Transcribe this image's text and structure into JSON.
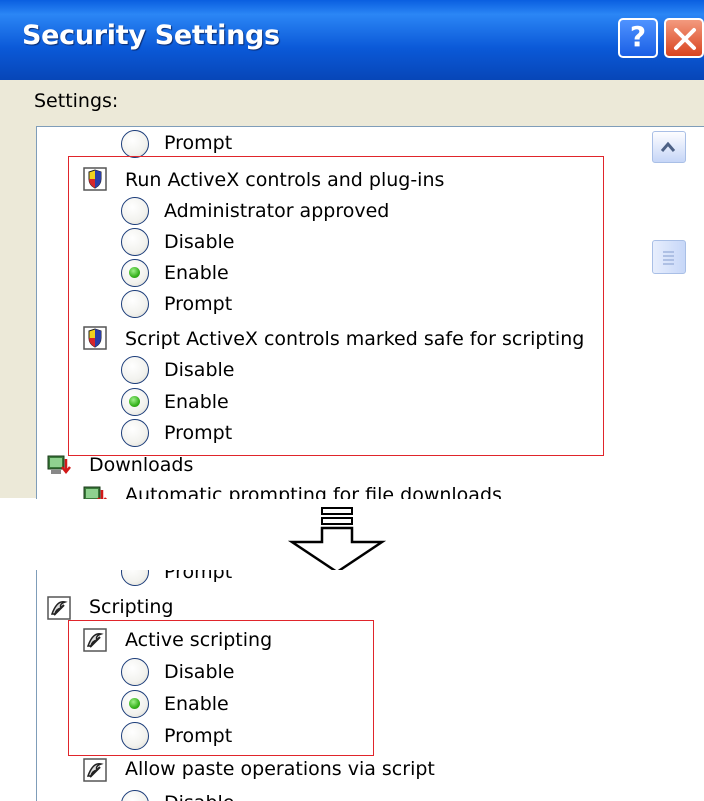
{
  "dialog": {
    "title": "Security Settings",
    "help_label": "?",
    "settings_label": "Settings:"
  },
  "top_list": {
    "prompt_top": "Prompt",
    "run_activex": {
      "label": "Run ActiveX controls and plug-ins",
      "options": [
        "Administrator approved",
        "Disable",
        "Enable",
        "Prompt"
      ],
      "selected": "Enable"
    },
    "script_activex": {
      "label": "Script ActiveX controls marked safe for scripting",
      "options": [
        "Disable",
        "Enable",
        "Prompt"
      ],
      "selected": "Enable"
    },
    "downloads": "Downloads",
    "auto_prompt": "Automatic prompting for file downloads"
  },
  "bottom_list": {
    "prompt_top": "Prompt",
    "scripting": "Scripting",
    "active_scripting": {
      "label": "Active scripting",
      "options": [
        "Disable",
        "Enable",
        "Prompt"
      ],
      "selected": "Enable"
    },
    "paste": "Allow paste operations via script",
    "paste_option": "Disable"
  },
  "colors": {
    "highlight": "#e0252b",
    "titlebar": "#0b59d8",
    "radio_selected": "#36b21c"
  },
  "icons": {
    "activex": "activex-shield-icon",
    "downloads": "downloads-icon",
    "scripting": "scripting-icon",
    "transition": "down-arrow-icon"
  }
}
